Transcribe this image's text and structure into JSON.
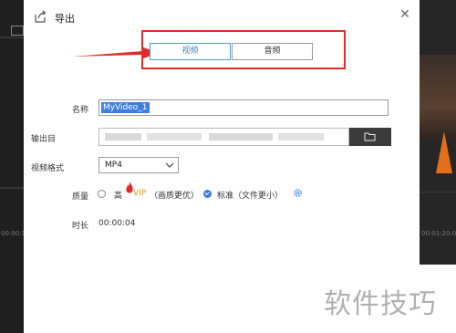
{
  "dialog": {
    "title": "导出",
    "tabs": [
      {
        "label": "视频",
        "selected": true
      },
      {
        "label": "音频",
        "selected": false
      }
    ]
  },
  "form": {
    "name_label": "名称",
    "name_value": "MyVideo_1",
    "output_label": "输出目",
    "format_label": "视频格式",
    "format_value": "MP4",
    "quality_label": "质量",
    "quality_high": "高",
    "quality_vip": "VIP",
    "quality_high_note": "（画质更优）",
    "quality_standard": "标准（文件更小）",
    "quality_selected": "standard",
    "duration_label": "时长",
    "duration_value": "00:00:04"
  },
  "background": {
    "watermark": "软件技巧",
    "timecode_right": "00:01:20:00",
    "timecode_left": "00:00:1"
  },
  "colors": {
    "accent": "#3d7ee3",
    "highlight_box": "#e22b2b",
    "vip": "#e89a1c"
  },
  "icons": [
    "export-icon",
    "close-icon",
    "folder-icon",
    "chevron-down-icon",
    "flame-icon",
    "gear-icon",
    "red-arrow"
  ]
}
